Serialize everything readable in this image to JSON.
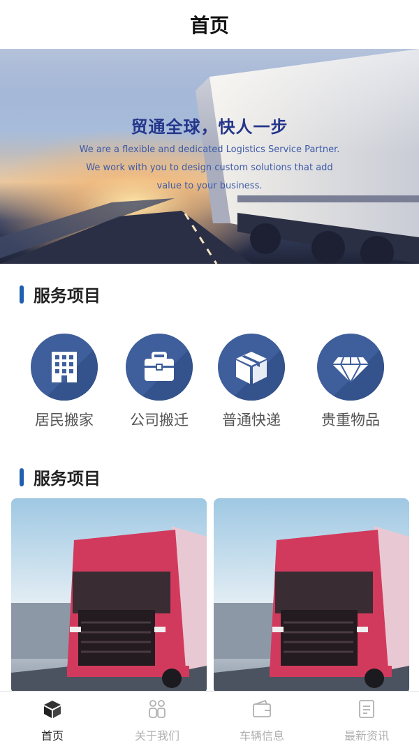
{
  "header": {
    "title": "首页"
  },
  "banner": {
    "headline": "贸通全球，快人一步",
    "sub_lines": [
      "We are a flexible and dedicated Logistics Service Partner.",
      "We work with you to design custom solutions that add",
      "value to your business."
    ],
    "dots": [
      {
        "active": true
      },
      {
        "active": false
      }
    ]
  },
  "services_section": {
    "title": "服务项目",
    "items": [
      {
        "label": "居民搬家",
        "icon": "building-icon"
      },
      {
        "label": "公司搬迁",
        "icon": "briefcase-icon"
      },
      {
        "label": "普通快递",
        "icon": "package-icon"
      },
      {
        "label": "贵重物品",
        "icon": "diamond-icon"
      }
    ]
  },
  "projects_section": {
    "title": "服务项目",
    "cards": [
      {
        "image": "red-truck-image"
      },
      {
        "image": "red-truck-image"
      }
    ]
  },
  "tabbar": {
    "tabs": [
      {
        "label": "首页",
        "icon": "cube-icon",
        "active": true
      },
      {
        "label": "关于我们",
        "icon": "people-icon",
        "active": false
      },
      {
        "label": "车辆信息",
        "icon": "wallet-icon",
        "active": false
      },
      {
        "label": "最新资讯",
        "icon": "document-icon",
        "active": false
      }
    ]
  },
  "colors": {
    "accent": "#1f5fb0",
    "service_circle": "#3f5f9c",
    "headline": "#25368a",
    "tab_inactive": "#b0b0b0"
  }
}
